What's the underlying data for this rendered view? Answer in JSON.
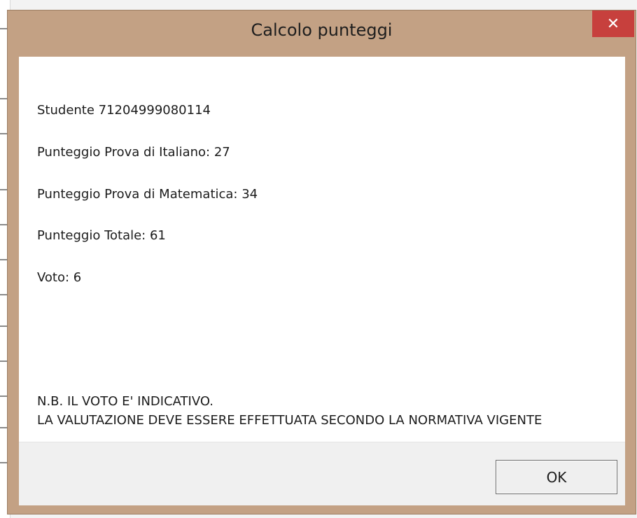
{
  "dialog": {
    "title": "Calcolo punteggi",
    "close_icon": "close-icon"
  },
  "message": {
    "student": "Studente 71204999080114",
    "italian_score": "Punteggio Prova di Italiano: 27",
    "math_score": "Punteggio Prova di Matematica: 34",
    "total_score": "Punteggio Totale: 61",
    "grade": "Voto: 6",
    "note_line1": "N.B. IL VOTO E' INDICATIVO.",
    "note_line2": "LA VALUTAZIONE DEVE ESSERE EFFETTUATA SECONDO LA NORMATIVA VIGENTE"
  },
  "buttons": {
    "ok_label": "OK"
  },
  "colors": {
    "title_bar": "#c3a184",
    "close_button": "#c7403d",
    "footer": "#f0f0f0"
  }
}
